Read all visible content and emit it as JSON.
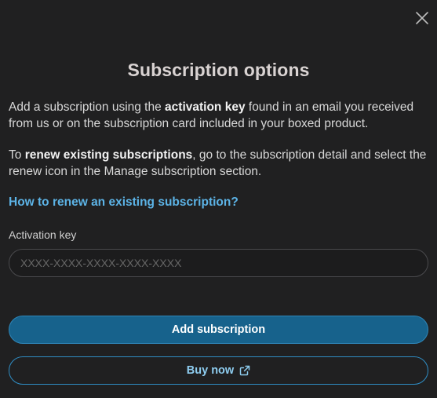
{
  "dialog": {
    "title": "Subscription options",
    "intro": {
      "before": "Add a subscription using the ",
      "bold": "activation key",
      "after": " found in an email you received from us or on the subscription card included in your boxed product."
    },
    "renew": {
      "before": "To ",
      "bold": "renew existing subscriptions",
      "after": ", go to the subscription detail and select the renew icon in the Manage subscription section."
    },
    "help_link": "How to renew an existing subscription?",
    "activation_key": {
      "label": "Activation key",
      "placeholder": "XXXX-XXXX-XXXX-XXXX-XXXX",
      "value": ""
    },
    "add_button": "Add subscription",
    "buy_button": "Buy now"
  },
  "icons": {
    "close": "close-icon",
    "external_link": "external-link-icon"
  },
  "colors": {
    "background": "#202021",
    "primary_button": "#17628c",
    "link": "#5cb3e6",
    "secondary_border": "#2f8dc4"
  }
}
